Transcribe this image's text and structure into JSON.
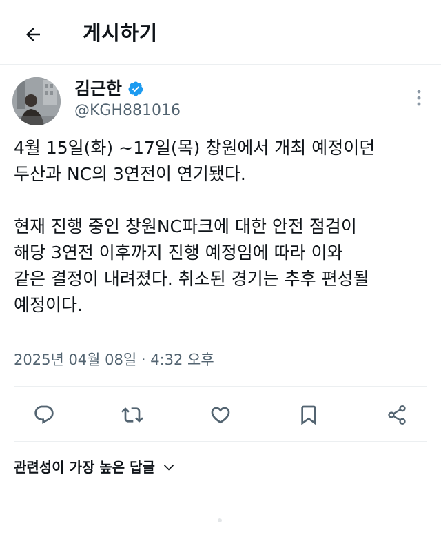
{
  "header": {
    "title": "게시하기",
    "back_icon": "arrow-left-icon"
  },
  "author": {
    "name": "김근한",
    "handle": "@KGH881016",
    "verified_color": "#1d9bf0"
  },
  "tweet": {
    "paragraph1_line1": "4월 15일(화) ~17일(목) 창원에서 개최 예정이던",
    "paragraph1_line2": "두산과 NC의 3연전이 연기됐다.",
    "paragraph2_line1": "현재 진행 중인 창원NC파크에 대한 안전 점검이",
    "paragraph2_line2": "해당 3연전 이후까지 진행 예정임에 따라 이와",
    "paragraph2_line3": "같은 결정이 내려졌다. 취소된 경기는 추후 편성될",
    "paragraph2_line4": "예정이다.",
    "timestamp": "2025년 04월 08일 · 4:32 오후"
  },
  "actions": {
    "reply_icon": "reply-icon",
    "retweet_icon": "retweet-icon",
    "like_icon": "heart-icon",
    "bookmark_icon": "bookmark-icon",
    "share_icon": "share-icon"
  },
  "replies": {
    "sort_label": "관련성이 가장 높은 답글"
  },
  "colors": {
    "text": "#0f1419",
    "secondary": "#536471",
    "accent": "#1d9bf0",
    "border": "#eceff1"
  }
}
